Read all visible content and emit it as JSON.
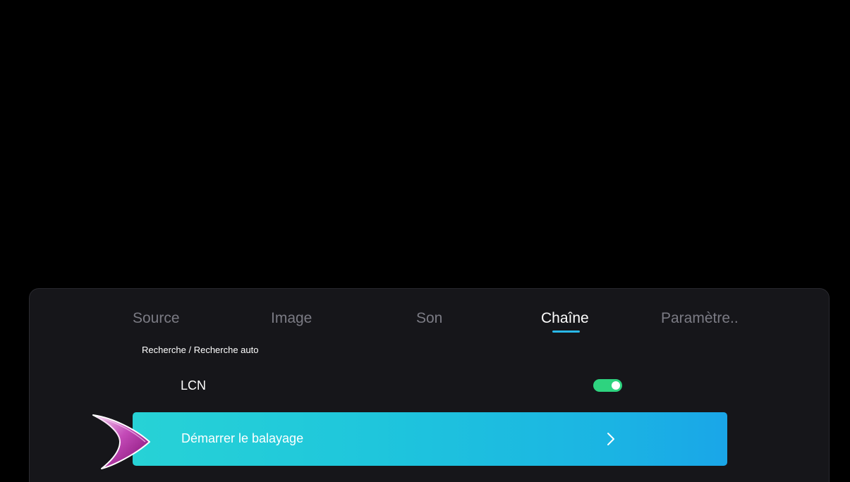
{
  "tabs": [
    {
      "label": "Source",
      "active": false
    },
    {
      "label": "Image",
      "active": false
    },
    {
      "label": "Son",
      "active": false
    },
    {
      "label": "Chaîne",
      "active": true
    },
    {
      "label": "Paramètre..",
      "active": false
    }
  ],
  "breadcrumb": "Recherche / Recherche auto",
  "settings": {
    "lcn": {
      "label": "LCN",
      "enabled": true
    },
    "scan": {
      "label": "Démarrer le balayage",
      "icon": "chevron-right-icon"
    }
  },
  "pointer": {
    "icon": "remote-pointer-arrow-icon"
  },
  "colors": {
    "background": "#000000",
    "panel": "#16161a",
    "tab_inactive": "#7b7b84",
    "tab_active": "#ffffff",
    "tab_underline": "#29b8e8",
    "toggle_on": "#2ed37f",
    "focus_start": "#27d2d6",
    "focus_end": "#1aa6e8",
    "pointer": "#b0179e"
  }
}
